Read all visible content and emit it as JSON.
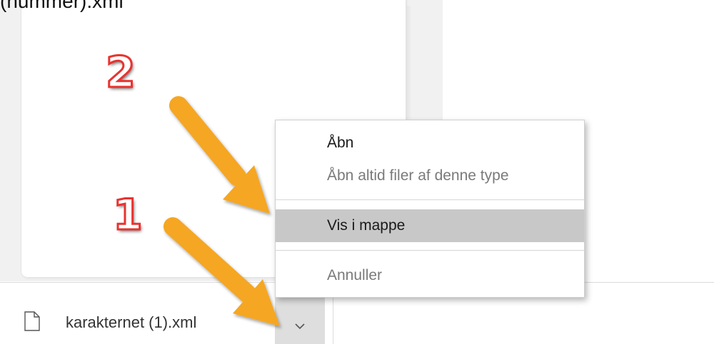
{
  "top_filename_fragment": "(nummer).xml",
  "annotations": {
    "step_1": "1",
    "step_2": "2"
  },
  "download_bar": {
    "file_name": "karakternet (1).xml",
    "file_icon": "document-icon",
    "menu_button_icon": "chevron-down-icon"
  },
  "context_menu": {
    "items": [
      {
        "label": "Åbn",
        "state": "enabled"
      },
      {
        "label": "Åbn altid filer af denne type",
        "state": "disabled"
      },
      {
        "label": "Vis i mappe",
        "state": "highlighted"
      },
      {
        "label": "Annuller",
        "state": "disabled"
      }
    ]
  },
  "colors": {
    "annotation_arrow": "#f5a623",
    "annotation_number_outline": "#e8332f",
    "menu_highlight": "#c8c8c8"
  }
}
